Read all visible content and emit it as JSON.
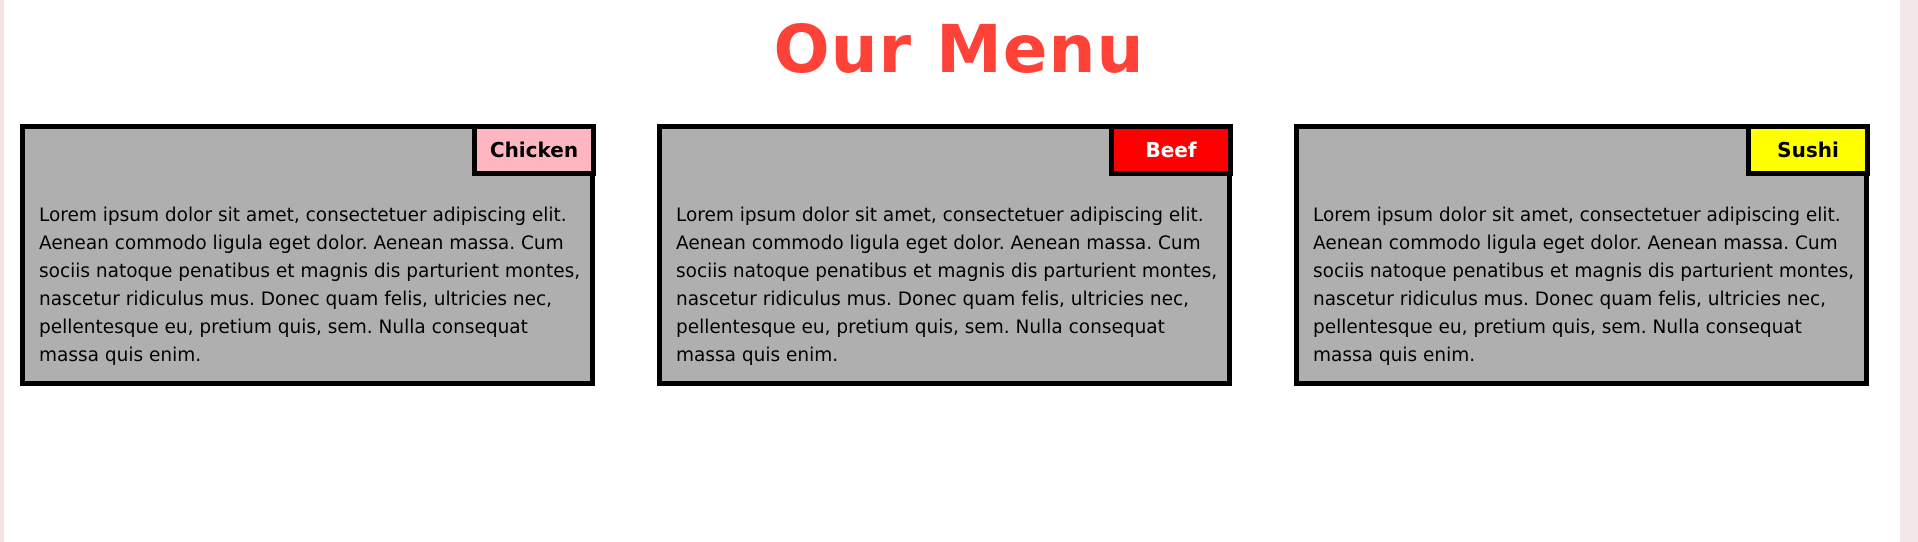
{
  "page": {
    "title": "Our Menu",
    "title_color": "#ff4238",
    "background": "#ffffff"
  },
  "menu": {
    "items": [
      {
        "label": "Chicken",
        "tag_color": "#ffb6c1",
        "text_color": "#000000",
        "description": "Lorem ipsum dolor sit amet, consectetuer adipiscing elit. Aenean commodo ligula eget dolor. Aenean massa. Cum sociis natoque penatibus et magnis dis parturient montes, nascetur ridiculus mus. Donec quam felis, ultricies nec, pellentesque eu, pretium quis, sem. Nulla consequat massa quis enim."
      },
      {
        "label": "Beef",
        "tag_color": "#ff0000",
        "text_color": "#ffffff",
        "description": "Lorem ipsum dolor sit amet, consectetuer adipiscing elit. Aenean commodo ligula eget dolor. Aenean massa. Cum sociis natoque penatibus et magnis dis parturient montes, nascetur ridiculus mus. Donec quam felis, ultricies nec, pellentesque eu, pretium quis, sem. Nulla consequat massa quis enim."
      },
      {
        "label": "Sushi",
        "tag_color": "#ffff00",
        "text_color": "#000000",
        "description": "Lorem ipsum dolor sit amet, consectetuer adipiscing elit. Aenean commodo ligula eget dolor. Aenean massa. Cum sociis natoque penatibus et magnis dis parturient montes, nascetur ridiculus mus. Donec quam felis, ultricies nec, pellentesque eu, pretium quis, sem. Nulla consequat massa quis enim."
      }
    ],
    "card_background": "#afafaf",
    "border_color": "#000000"
  }
}
